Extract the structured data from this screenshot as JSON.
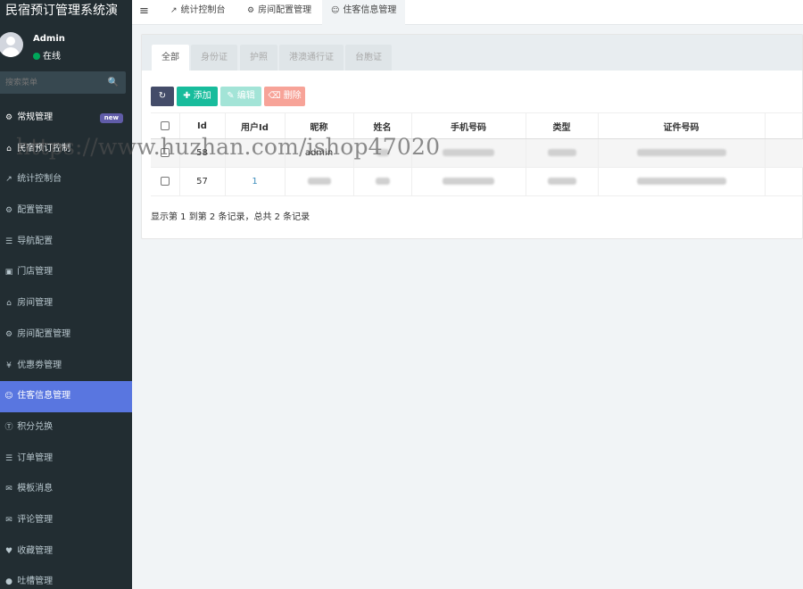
{
  "app": {
    "brand": "民宿预订管理系统演"
  },
  "user": {
    "name": "Admin",
    "status": "在线"
  },
  "search": {
    "placeholder": "搜索菜单"
  },
  "menu": [
    {
      "label": "常规管理",
      "icon": "gears-icon",
      "badge": "new"
    },
    {
      "label": "民宿预订控制",
      "icon": "home-icon"
    },
    {
      "label": "统计控制台",
      "icon": "line-chart-icon"
    },
    {
      "label": "配置管理",
      "icon": "gear-icon"
    },
    {
      "label": "导航配置",
      "icon": "list-icon"
    },
    {
      "label": "门店管理",
      "icon": "bank-icon"
    },
    {
      "label": "房间管理",
      "icon": "home-icon"
    },
    {
      "label": "房间配置管理",
      "icon": "gear-icon"
    },
    {
      "label": "优惠劵管理",
      "icon": "yen-icon"
    },
    {
      "label": "住客信息管理",
      "icon": "user-icon"
    },
    {
      "label": "积分兑换",
      "icon": "pinterest-icon"
    },
    {
      "label": "订单管理",
      "icon": "list-icon"
    },
    {
      "label": "模板消息",
      "icon": "envelope-icon"
    },
    {
      "label": "评论管理",
      "icon": "comments-icon"
    },
    {
      "label": "收藏管理",
      "icon": "heart-icon"
    },
    {
      "label": "吐槽管理",
      "icon": "comment-icon"
    }
  ],
  "topbar": {
    "tabs": [
      {
        "label": "统计控制台",
        "icon": "line-chart-icon"
      },
      {
        "label": "房间配置管理",
        "icon": "gear-icon"
      },
      {
        "label": "住客信息管理",
        "icon": "user-icon"
      }
    ]
  },
  "panel": {
    "tabs": [
      "全部",
      "身份证",
      "护照",
      "港澳通行证",
      "台胞证"
    ],
    "toolbar": {
      "add": "添加",
      "edit": "编辑",
      "delete": "删除"
    },
    "columns": [
      "Id",
      "用户Id",
      "昵称",
      "姓名",
      "手机号码",
      "类型",
      "证件号码"
    ],
    "rows": [
      {
        "id": "58",
        "user_id": "",
        "nickname": "admin",
        "name": "",
        "phone": "",
        "type": "",
        "id_number": ""
      },
      {
        "id": "57",
        "user_id": "1",
        "nickname": "",
        "name": "",
        "phone": "",
        "type": "",
        "id_number": ""
      }
    ],
    "pagination_info": "显示第 1 到第 2 条记录，总共 2 条记录"
  },
  "watermark": "https://www.huzhan.com/ishop47020",
  "colors": {
    "sidebar_bg": "#222d32",
    "active_menu": "#5976e0",
    "btn_refresh": "#444c69",
    "btn_add": "#18bc9c",
    "btn_edit": "#a3e4d7",
    "btn_delete": "#f7a398",
    "status_online": "#00a65a",
    "badge_new": "#605ca8"
  }
}
